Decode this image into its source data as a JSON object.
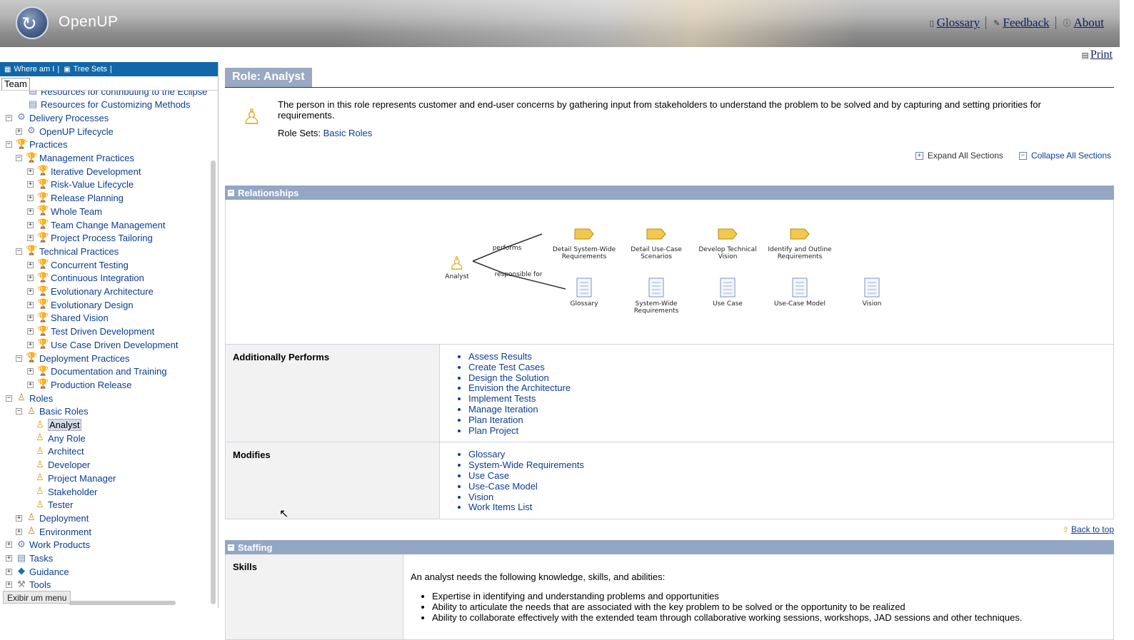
{
  "header": {
    "app_title": "OpenUP",
    "links": {
      "glossary": "Glossary",
      "feedback": "Feedback",
      "about": "About"
    }
  },
  "print_label": "Print",
  "nav": {
    "where_am_i": "Where am I",
    "tree_sets": "Tree Sets",
    "tab": "Team",
    "tooltip": "Exibir um menu",
    "tree": [
      {
        "label": "Resources for contributing to the Eclipse Process Framework",
        "exp": "",
        "icon": "page"
      },
      {
        "label": "Resources for Customizing Methods",
        "exp": "",
        "icon": "page"
      },
      {
        "label": "Delivery Processes",
        "exp": "−",
        "icon": "proc"
      },
      {
        "label": "OpenUP Lifecycle",
        "exp": "+",
        "icon": "proc"
      },
      {
        "label": "Practices",
        "exp": "−",
        "icon": "trophy"
      },
      {
        "label": "Management Practices",
        "exp": "−",
        "icon": "trophy"
      },
      {
        "label": "Iterative Development",
        "exp": "+",
        "icon": "trophy"
      },
      {
        "label": "Risk-Value Lifecycle",
        "exp": "+",
        "icon": "trophy"
      },
      {
        "label": "Release Planning",
        "exp": "+",
        "icon": "trophy"
      },
      {
        "label": "Whole Team",
        "exp": "+",
        "icon": "trophy"
      },
      {
        "label": "Team Change Management",
        "exp": "+",
        "icon": "trophy"
      },
      {
        "label": "Project Process Tailoring",
        "exp": "+",
        "icon": "trophy"
      },
      {
        "label": "Technical Practices",
        "exp": "−",
        "icon": "trophy"
      },
      {
        "label": "Concurrent Testing",
        "exp": "+",
        "icon": "trophy"
      },
      {
        "label": "Continuous Integration",
        "exp": "+",
        "icon": "trophy"
      },
      {
        "label": "Evolutionary Architecture",
        "exp": "+",
        "icon": "trophy"
      },
      {
        "label": "Evolutionary Design",
        "exp": "+",
        "icon": "trophy"
      },
      {
        "label": "Shared Vision",
        "exp": "+",
        "icon": "trophy"
      },
      {
        "label": "Test Driven Development",
        "exp": "+",
        "icon": "trophy"
      },
      {
        "label": "Use Case Driven Development",
        "exp": "+",
        "icon": "trophy"
      },
      {
        "label": "Deployment Practices",
        "exp": "−",
        "icon": "trophy"
      },
      {
        "label": "Documentation and Training",
        "exp": "+",
        "icon": "trophy"
      },
      {
        "label": "Production Release",
        "exp": "+",
        "icon": "trophy"
      },
      {
        "label": "Roles",
        "exp": "−",
        "icon": "roleset"
      },
      {
        "label": "Basic Roles",
        "exp": "−",
        "icon": "roleset"
      },
      {
        "label": "Analyst",
        "exp": "",
        "icon": "role",
        "selected": true
      },
      {
        "label": "Any Role",
        "exp": "",
        "icon": "role"
      },
      {
        "label": "Architect",
        "exp": "",
        "icon": "role"
      },
      {
        "label": "Developer",
        "exp": "",
        "icon": "role"
      },
      {
        "label": "Project Manager",
        "exp": "",
        "icon": "role"
      },
      {
        "label": "Stakeholder",
        "exp": "",
        "icon": "role"
      },
      {
        "label": "Tester",
        "exp": "",
        "icon": "role"
      },
      {
        "label": "Deployment",
        "exp": "+",
        "icon": "roleset"
      },
      {
        "label": "Environment",
        "exp": "+",
        "icon": "roleset"
      },
      {
        "label": "Work Products",
        "exp": "+",
        "icon": "proc"
      },
      {
        "label": "Tasks",
        "exp": "+",
        "icon": "page"
      },
      {
        "label": "Guidance",
        "exp": "+",
        "icon": "guide"
      },
      {
        "label": "Tools",
        "exp": "+",
        "icon": "tool"
      }
    ]
  },
  "page": {
    "title": "Role: Analyst",
    "description": "The person in this role represents customer and end-user concerns by gathering input from stakeholders to understand the problem to be solved and by capturing and setting priorities for requirements.",
    "role_sets_label": "Role Sets:",
    "role_sets_value": "Basic Roles",
    "expand_all": "Expand All Sections",
    "collapse_all": "Collapse All Sections",
    "back_to_top": "Back to top"
  },
  "relationships": {
    "header": "Relationships",
    "diagram": {
      "role": "Analyst",
      "performs_label": "performs",
      "responsible_label": "responsible for",
      "tasks": [
        "Detail System-Wide Requirements",
        "Detail Use-Case Scenarios",
        "Develop Technical Vision",
        "Identify and Outline Requirements"
      ],
      "work_products": [
        "Glossary",
        "System-Wide Requirements",
        "Use Case",
        "Use-Case Model",
        "Vision"
      ]
    },
    "additionally_performs_label": "Additionally Performs",
    "additionally_performs": [
      "Assess Results",
      "Create Test Cases",
      "Design the Solution",
      "Envision the Architecture",
      "Implement Tests",
      "Manage Iteration",
      "Plan Iteration",
      "Plan Project"
    ],
    "modifies_label": "Modifies",
    "modifies": [
      "Glossary",
      "System-Wide Requirements",
      "Use Case",
      "Use-Case Model",
      "Vision",
      "Work Items List"
    ]
  },
  "staffing": {
    "header": "Staffing",
    "skills_label": "Skills",
    "intro": "An analyst needs the following knowledge, skills, and abilities:",
    "items": [
      "Expertise in identifying and understanding problems and opportunities",
      "Ability to articulate the needs that are associated with the key problem to be solved or the opportunity to be realized",
      "Ability to collaborate effectively with the extended team through collaborative working sessions, workshops, JAD sessions and other techniques."
    ]
  }
}
